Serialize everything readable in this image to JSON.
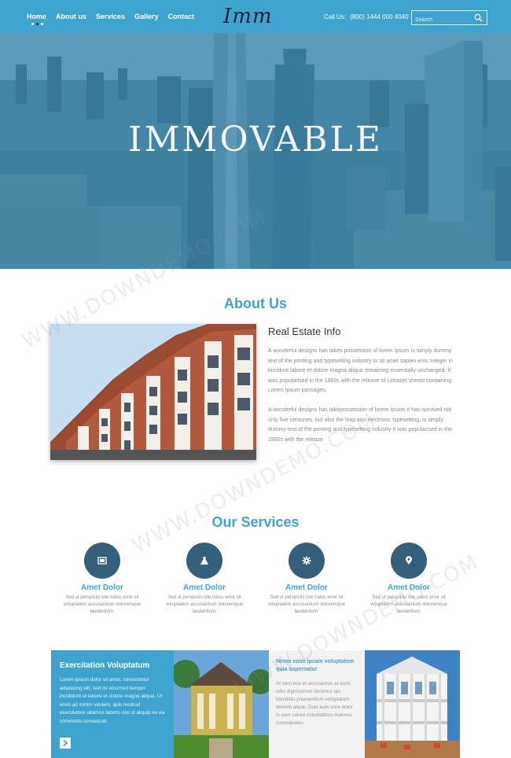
{
  "nav": {
    "items": [
      {
        "label": "Home"
      },
      {
        "label": "About us"
      },
      {
        "label": "Services"
      },
      {
        "label": "Gallery"
      },
      {
        "label": "Contact"
      }
    ]
  },
  "logo": "Imm",
  "call": {
    "label": "Call Us:",
    "number": "(800) 1444 000 4040"
  },
  "search": {
    "placeholder": "Search"
  },
  "hero": {
    "title": "IMMOVABLE"
  },
  "about": {
    "title": "About Us",
    "heading": "Real Estate Info",
    "p1": "A wonderful designs has takes possession of lorem Ipsum is simply dummy text of the printing and typesetting industry In sit amet sapien eros Integer in tincidunt labore et dolore magna aliqua remaining essentially unchanged. It was popularised in the 1960s with the release of Letraset sheets containing Lorem Ipsum passages.",
    "p2": "A wonderful designs has takepossession of lorem Ipsum It has survived not only five centuries, but also the leap into electronic typesetting, is simply dummy text of the printing and typesetting industry It was popularised in the 1960s with the release"
  },
  "services": {
    "title": "Our Services",
    "items": [
      {
        "title": "Amet Dolor",
        "text": "Sed ut perspiciis iste natus error sit voluptatem accusantium doloremque laudantium.",
        "icon": "image-icon"
      },
      {
        "title": "Amet Dolor",
        "text": "Sed ut perspiciis iste natus error sit voluptatem accusantium doloremque laudantium.",
        "icon": "flask-icon"
      },
      {
        "title": "Amet Dolor",
        "text": "Sed ut perspiciis iste natus error sit voluptatem accusantium doloremque laudantium.",
        "icon": "gear-icon"
      },
      {
        "title": "Amet Dolor",
        "text": "Sed ut perspiciis iste natus error sit voluptatem accusantium doloremque laudantium.",
        "icon": "map-marker-icon"
      }
    ]
  },
  "features": {
    "box1": {
      "title": "Exercitation Voluptatum",
      "text": "Lorem ipsum dolor sit amet, consectetur adipiscing elit, sed do eiusmod tempor incididunt ut labore et dolore magna aliqua. Ut enim ad minim veniam, quis nostrud exercitation ullamco laboris nisi ut aliquip ex ea commodo consequat."
    },
    "box2": {
      "title": "Nemo enim ipsam voluptatem quia aspernatur",
      "text": "At vero eos et accusamus et iusto odio dignissimos ducimus qui blanditiis praesentium voluptatum deleniti atque. Duis aute irure dolor in cum soluta voluptatibus maiores consequatur."
    }
  },
  "watermark": "WWW.DOWNDEMO.COM",
  "colors": {
    "accent": "#3ea3cf",
    "circle": "#34607c"
  }
}
